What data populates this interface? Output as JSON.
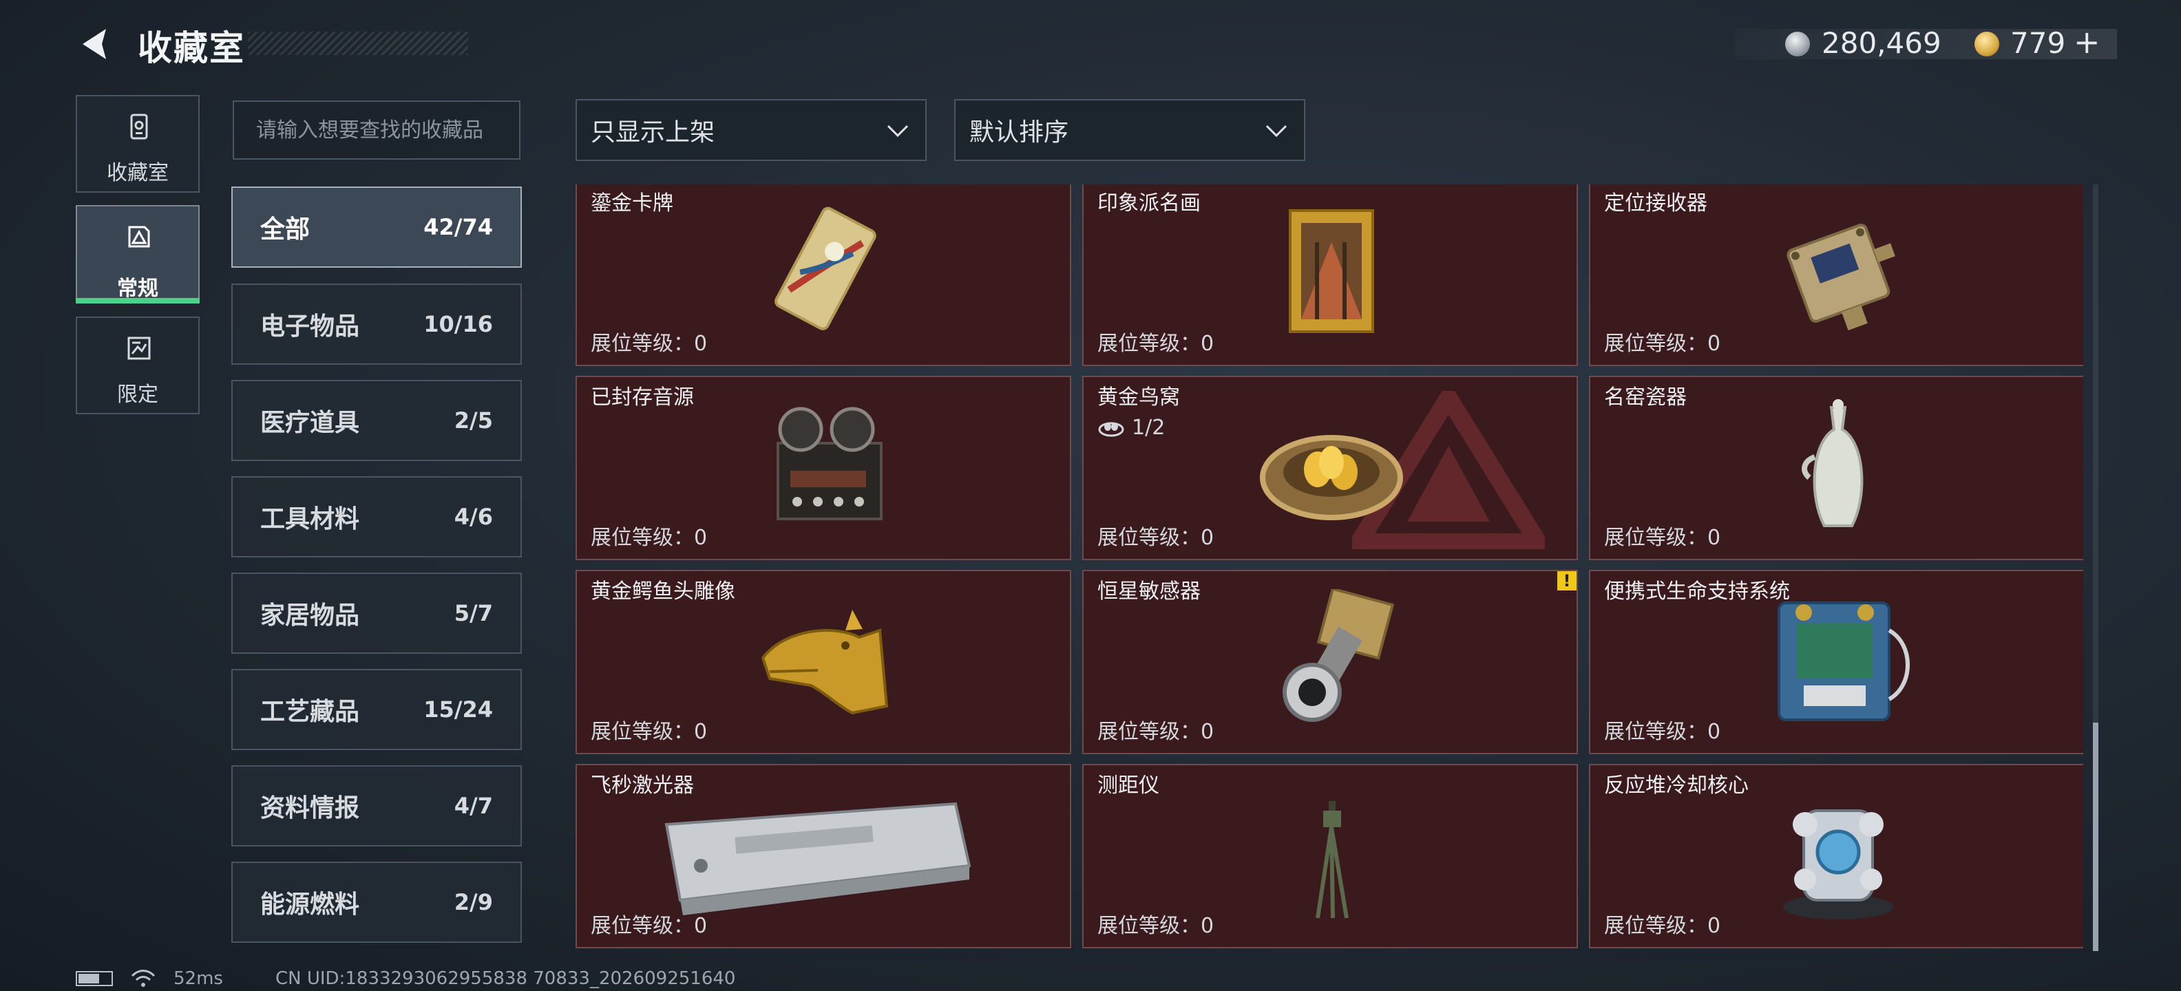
{
  "header": {
    "title": "收藏室",
    "silver_amount": "280,469",
    "gold_amount": "779",
    "plus": "+"
  },
  "nav": {
    "tabs": [
      {
        "label": "收藏室",
        "icon": "collection-room-icon",
        "active": false
      },
      {
        "label": "常规",
        "icon": "regular-icon",
        "active": true
      },
      {
        "label": "限定",
        "icon": "limited-icon",
        "active": false
      }
    ]
  },
  "search": {
    "placeholder": "请输入想要查找的收藏品"
  },
  "filters": {
    "display": "只显示上架",
    "sort": "默认排序"
  },
  "categories": [
    {
      "label": "全部",
      "count": "42/74",
      "active": true
    },
    {
      "label": "电子物品",
      "count": "10/16"
    },
    {
      "label": "医疗道具",
      "count": "2/5"
    },
    {
      "label": "工具材料",
      "count": "4/6"
    },
    {
      "label": "家居物品",
      "count": "5/7"
    },
    {
      "label": "工艺藏品",
      "count": "15/24"
    },
    {
      "label": "资料情报",
      "count": "4/7"
    },
    {
      "label": "能源燃料",
      "count": "2/9"
    }
  ],
  "items": [
    {
      "name": "鎏金卡牌",
      "level": "展位等级：0",
      "icon": "gilded-card-icon"
    },
    {
      "name": "印象派名画",
      "level": "展位等级：0",
      "icon": "framed-painting-icon"
    },
    {
      "name": "定位接收器",
      "level": "展位等级：0",
      "icon": "locator-receiver-icon"
    },
    {
      "name": "已封存音源",
      "level": "展位等级：0",
      "icon": "reel-tape-recorder-icon"
    },
    {
      "name": "黄金鸟窝",
      "level": "展位等级：0",
      "count": "1/2",
      "icon": "golden-nest-icon"
    },
    {
      "name": "名窑瓷器",
      "level": "展位等级：0",
      "icon": "porcelain-vase-icon"
    },
    {
      "name": "黄金鳄鱼头雕像",
      "level": "展位等级：0",
      "icon": "golden-crocodile-head-icon"
    },
    {
      "name": "恒星敏感器",
      "level": "展位等级：0",
      "icon": "star-sensor-icon",
      "badge": "!"
    },
    {
      "name": "便携式生命支持系统",
      "level": "展位等级：0",
      "icon": "life-support-icon"
    },
    {
      "name": "飞秒激光器",
      "level": "展位等级：0",
      "icon": "femtosecond-laser-icon"
    },
    {
      "name": "测距仪",
      "level": "展位等级：0",
      "icon": "rangefinder-tripod-icon"
    },
    {
      "name": "反应堆冷却核心",
      "level": "展位等级：0",
      "icon": "reactor-core-icon"
    }
  ],
  "status": {
    "ping": "52ms",
    "uid": "CN UID:1833293062955838 70833_202609251640"
  }
}
